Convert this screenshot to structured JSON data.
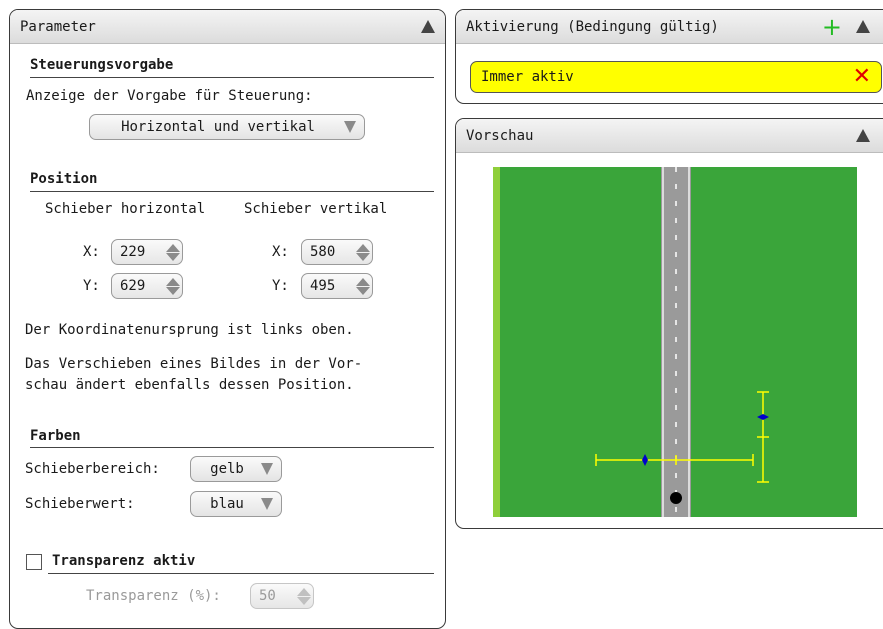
{
  "parameter": {
    "title": "Parameter",
    "steuerung": {
      "title": "Steuerungsvorgabe",
      "label": "Anzeige der Vorgabe für Steuerung:",
      "selected": "Horizontal und vertikal"
    },
    "position": {
      "title": "Position",
      "horizontal_header": "Schieber horizontal",
      "vertical_header": "Schieber vertikal",
      "x_label": "X:",
      "y_label": "Y:",
      "h_x": "229",
      "h_y": "629",
      "v_x": "580",
      "v_y": "495",
      "info1": "Der Koordinatenursprung ist links oben.",
      "info2_line1": "Das Verschieben eines Bildes in der Vor-",
      "info2_line2": "schau ändert ebenfalls dessen Position."
    },
    "farben": {
      "title": "Farben",
      "bereich_label": "Schieberbereich:",
      "bereich_value": "gelb",
      "wert_label": "Schieberwert:",
      "wert_value": "blau"
    },
    "transparenz": {
      "checkbox_label": "Transparenz aktiv",
      "checked": false,
      "label": "Transparenz (%):",
      "value": "50"
    }
  },
  "aktivierung": {
    "title": "Aktivierung (Bedingung gültig)",
    "condition": "Immer aktiv"
  },
  "vorschau": {
    "title": "Vorschau"
  },
  "colors": {
    "grass": "#3aa53a",
    "road": "#9a9a9a",
    "slider_range": "#ffff00",
    "slider_value": "#0000cc",
    "condition_bg": "#ffff00"
  }
}
